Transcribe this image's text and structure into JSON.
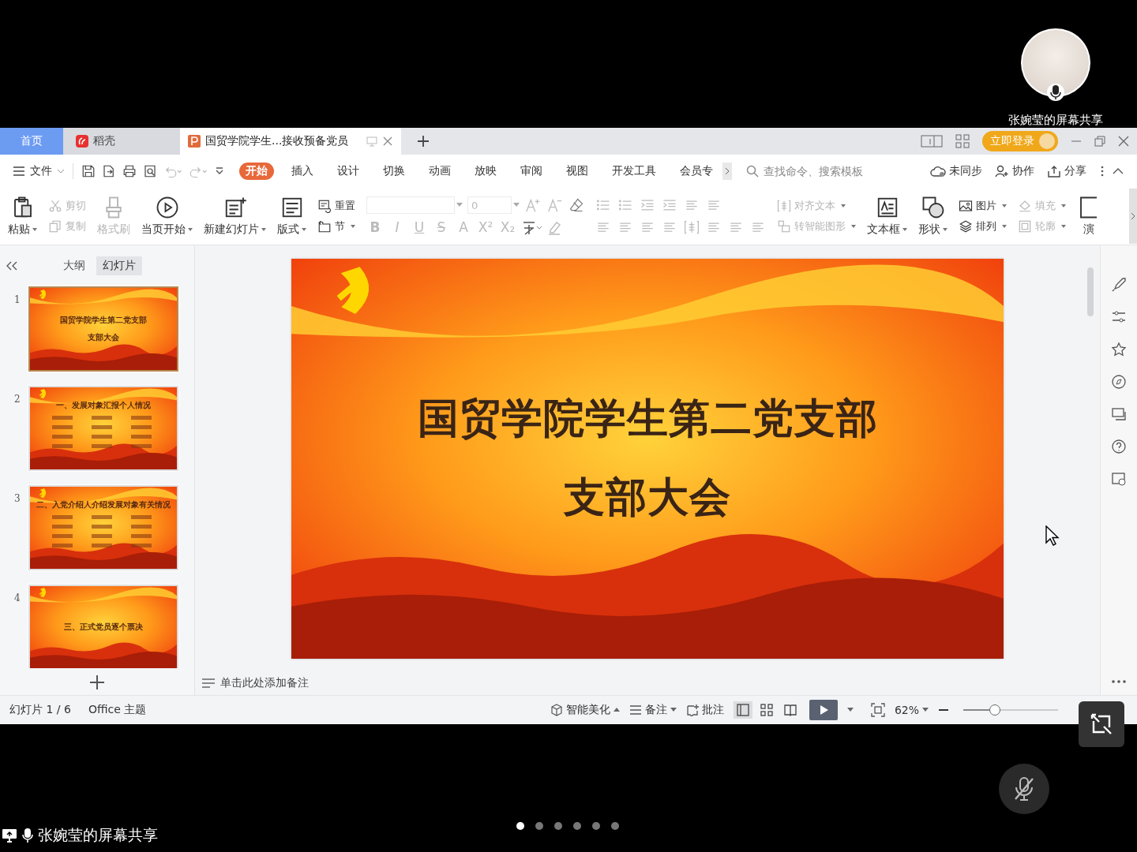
{
  "share": {
    "presenter_label": "张婉莹的屏幕共享",
    "caption": "张婉莹的屏幕共享",
    "mic_muted": true,
    "page_dots": [
      {
        "selected": true
      },
      {
        "selected": false
      },
      {
        "selected": false
      },
      {
        "selected": false
      },
      {
        "selected": false
      },
      {
        "selected": false
      }
    ]
  },
  "tabs": [
    {
      "kind": "home",
      "label": "首页",
      "selected": false
    },
    {
      "kind": "docer",
      "label": "稻壳",
      "selected": false
    },
    {
      "kind": "document",
      "label": "国贸学院学生...接收预备党员",
      "selected": true
    }
  ],
  "login_button": "立即登录",
  "menu": {
    "file": "文件",
    "ribbon_tabs": [
      {
        "label": "开始",
        "selected": true
      },
      {
        "label": "插入",
        "selected": false
      },
      {
        "label": "设计",
        "selected": false
      },
      {
        "label": "切换",
        "selected": false
      },
      {
        "label": "动画",
        "selected": false
      },
      {
        "label": "放映",
        "selected": false
      },
      {
        "label": "审阅",
        "selected": false
      },
      {
        "label": "视图",
        "selected": false
      },
      {
        "label": "开发工具",
        "selected": false
      },
      {
        "label": "会员专",
        "selected": false
      }
    ],
    "search": {
      "placeholder": "查找命令、搜索模板"
    },
    "actions": [
      "未同步",
      "协作",
      "分享"
    ]
  },
  "ribbon": [
    {
      "kind": "large",
      "label": "粘贴",
      "dropdown": true,
      "disabled": false
    },
    {
      "kind": "stack",
      "items": [
        {
          "label": "剪切",
          "dropdown": false,
          "disabled": true
        },
        {
          "label": "复制",
          "dropdown": false,
          "disabled": true
        }
      ]
    },
    {
      "kind": "large",
      "label": "格式刷",
      "dropdown": false,
      "disabled": true
    },
    {
      "kind": "large",
      "label": "当页开始",
      "dropdown": true,
      "disabled": false
    },
    {
      "kind": "large",
      "label": "新建幻灯片",
      "dropdown": true,
      "disabled": false
    },
    {
      "kind": "large",
      "label": "版式",
      "dropdown": true,
      "disabled": false
    },
    {
      "kind": "stack",
      "items": [
        {
          "label": "重置",
          "dropdown": false,
          "disabled": false
        },
        {
          "label": "节",
          "dropdown": true,
          "disabled": false
        }
      ]
    },
    {
      "kind": "font",
      "size": "0",
      "format_buttons": [
        "B",
        "I",
        "U",
        "S",
        "A",
        "X²",
        "X₂"
      ]
    },
    {
      "kind": "paragraph"
    },
    {
      "kind": "stack",
      "items": [
        {
          "label": "对齐文本",
          "dropdown": true,
          "disabled": true
        },
        {
          "label": "转智能图形",
          "dropdown": true,
          "disabled": true
        }
      ]
    },
    {
      "kind": "large",
      "label": "文本框",
      "dropdown": true,
      "disabled": false
    },
    {
      "kind": "large",
      "label": "形状",
      "dropdown": true,
      "disabled": false
    },
    {
      "kind": "stack",
      "items": [
        {
          "label": "图片",
          "dropdown": true,
          "disabled": false
        },
        {
          "label": "排列",
          "dropdown": true,
          "disabled": false
        }
      ]
    },
    {
      "kind": "stack",
      "items": [
        {
          "label": "填充",
          "dropdown": true,
          "disabled": true
        },
        {
          "label": "轮廓",
          "dropdown": true,
          "disabled": true
        }
      ]
    },
    {
      "kind": "large",
      "label": "演",
      "dropdown": false,
      "disabled": false
    }
  ],
  "panel": {
    "tabs": [
      {
        "label": "大纲",
        "selected": false
      },
      {
        "label": "幻灯片",
        "selected": true
      }
    ],
    "thumbnails": [
      {
        "number": "1",
        "kind": "title",
        "lines": [
          "国贸学院学生第二党支部",
          "支部大会"
        ],
        "selected": true
      },
      {
        "number": "2",
        "kind": "list",
        "lines": [
          "一、发展对象汇报个人情况"
        ],
        "selected": false
      },
      {
        "number": "3",
        "kind": "list",
        "lines": [
          "二、入党介绍人介绍发展对象有关情况"
        ],
        "selected": false
      },
      {
        "number": "4",
        "kind": "title",
        "lines": [
          "三、正式党员逐个票决"
        ],
        "selected": false
      }
    ]
  },
  "slide": {
    "title_lines": [
      "国贸学院学生第二党支部",
      "支部大会"
    ]
  },
  "notes_placeholder": "单击此处添加备注",
  "status_bar": {
    "slide_counter": "幻灯片 1 / 6",
    "theme": "Office 主题",
    "beautify": "智能美化",
    "notes": "备注",
    "comments": "批注",
    "views": [
      {
        "selected": true
      },
      {
        "selected": false
      },
      {
        "selected": false
      }
    ],
    "zoom": "62%",
    "zoom_slider": {
      "level": 0.35
    }
  }
}
